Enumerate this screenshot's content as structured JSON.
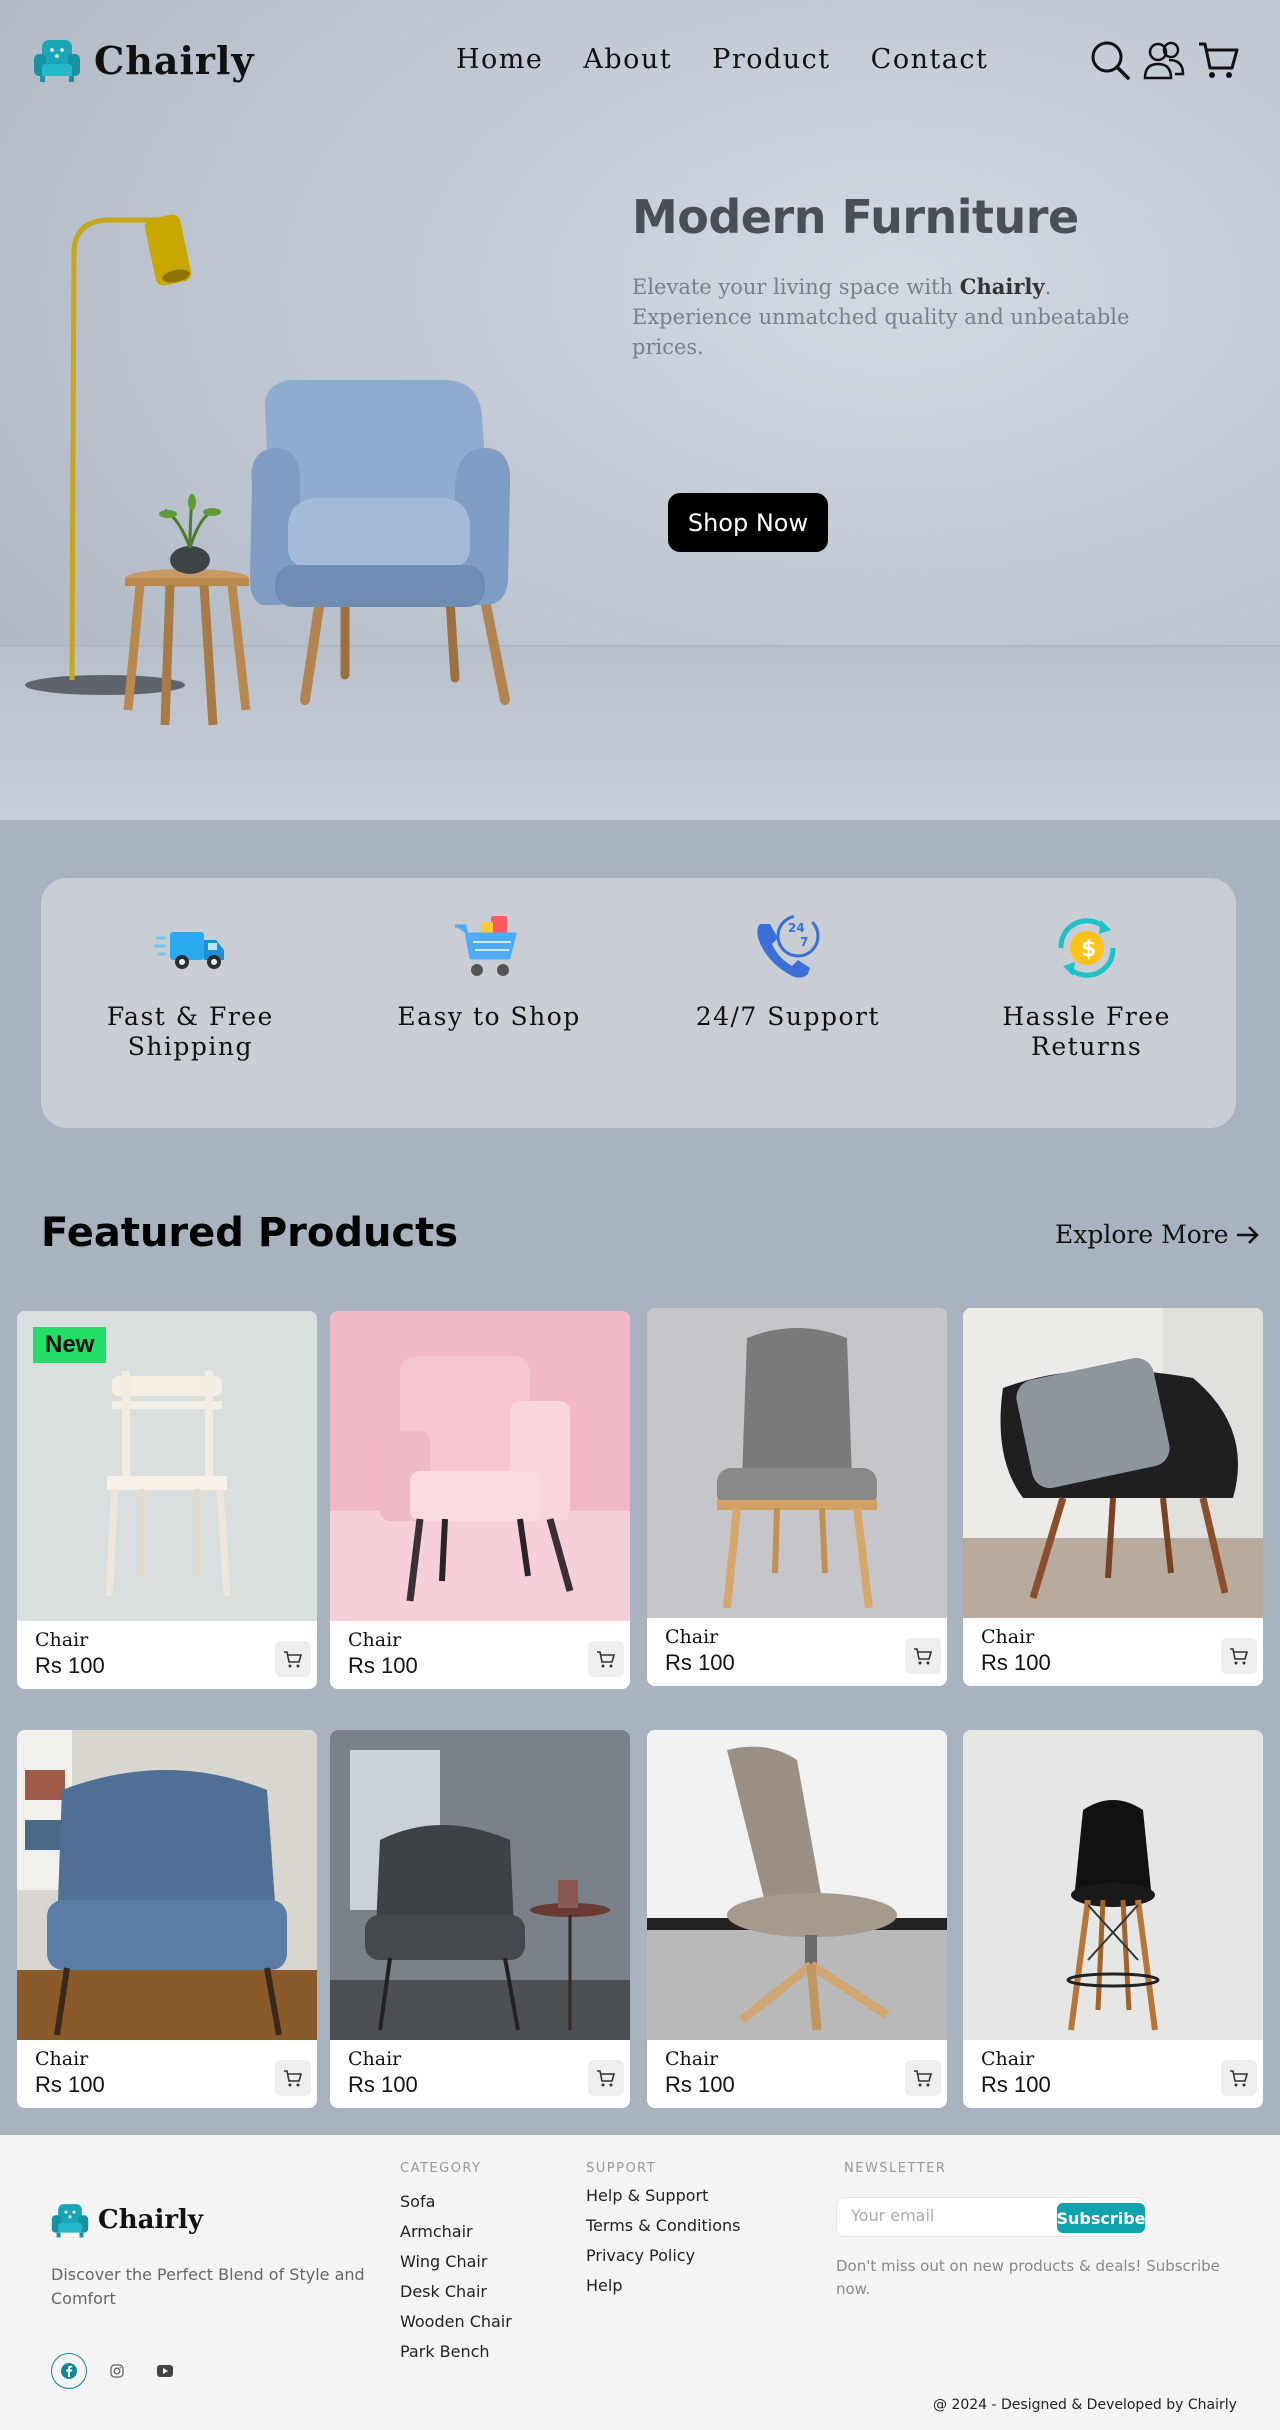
{
  "brand": {
    "name": "Chairly",
    "icon": "armchair-logo-icon",
    "color": "#1aa6b7"
  },
  "nav": {
    "links": [
      "Home",
      "About",
      "Product",
      "Contact"
    ],
    "icons": [
      "search-icon",
      "users-icon",
      "cart-icon"
    ]
  },
  "hero": {
    "title": "Modern Furniture",
    "subtitle_before": "Elevate your living space with ",
    "subtitle_brand": "Chairly",
    "subtitle_after": ". Experience unmatched quality and unbeatable prices.",
    "cta": "Shop Now"
  },
  "features": [
    {
      "label": "Fast & Free Shipping",
      "icon": "delivery-truck-icon"
    },
    {
      "label": "Easy to Shop",
      "icon": "shopping-cart-icon"
    },
    {
      "label": "24/7 Support",
      "icon": "phone-support-icon"
    },
    {
      "label": "Hassle Free Returns",
      "icon": "money-return-icon"
    }
  ],
  "featured": {
    "title": "Featured Products",
    "explore": "Explore More",
    "badge": "New",
    "products": [
      {
        "name": "Chair",
        "price": "Rs 100",
        "badge": true
      },
      {
        "name": "Chair",
        "price": "Rs 100"
      },
      {
        "name": "Chair",
        "price": "Rs 100"
      },
      {
        "name": "Chair",
        "price": "Rs 100"
      },
      {
        "name": "Chair",
        "price": "Rs 100"
      },
      {
        "name": "Chair",
        "price": "Rs 100"
      },
      {
        "name": "Chair",
        "price": "Rs 100"
      },
      {
        "name": "Chair",
        "price": "Rs 100"
      }
    ]
  },
  "footer": {
    "brand": "Chairly",
    "tagline": "Discover the Perfect Blend of Style and Comfort",
    "social": [
      "facebook-icon",
      "instagram-icon",
      "youtube-icon"
    ],
    "category": {
      "title": "CATEGORY",
      "items": [
        "Sofa",
        "Armchair",
        "Wing Chair",
        "Desk Chair",
        "Wooden Chair",
        "Park Bench"
      ]
    },
    "support": {
      "title": "SUPPORT",
      "items": [
        "Help & Support",
        "Terms & Conditions",
        "Privacy Policy",
        "Help"
      ]
    },
    "newsletter": {
      "title": "NEWSLETTER",
      "placeholder": "Your email",
      "button": "Subscribe",
      "note": "Don't miss out on new products & deals! Subscribe now."
    },
    "copyright": "@ 2024 - Designed & Developed by Chairly"
  }
}
